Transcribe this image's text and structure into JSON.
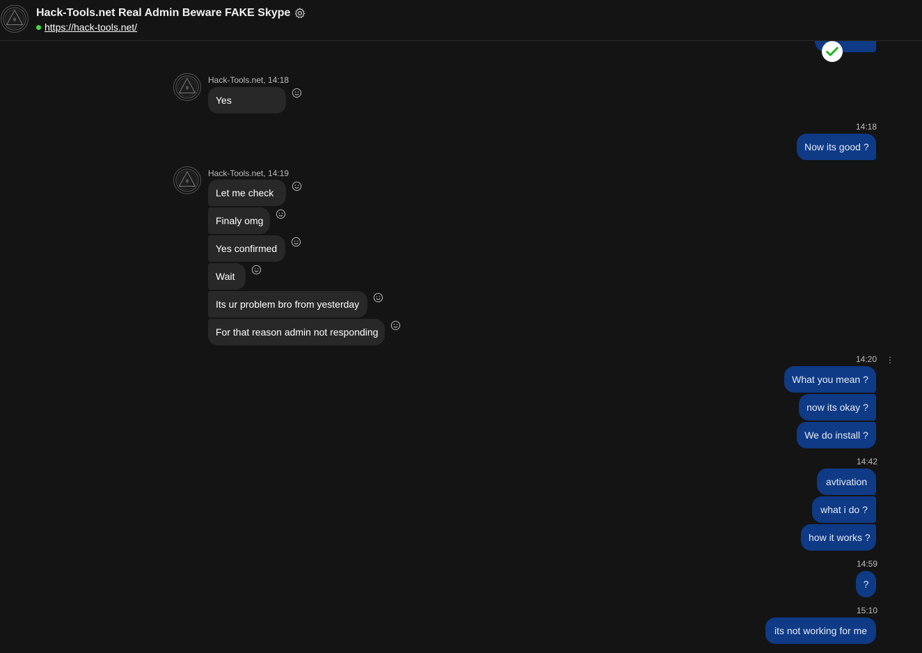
{
  "header": {
    "title": "Hack-Tools.net Real Admin Beware FAKE Skype",
    "url": "https://hack-tools.net/",
    "status": "online",
    "status_color": "#3ddc3d"
  },
  "colors": {
    "incoming_bubble": "#282828",
    "outgoing_bubble": "#0e3a86",
    "background": "#141414"
  },
  "messages": {
    "top_outgoing_read_icon": "check-circle-icon",
    "group1": {
      "sender": "Hack-Tools.net, 14:18",
      "items": [
        "Yes"
      ]
    },
    "group2": {
      "time": "14:18",
      "items": [
        "Now its good ?"
      ]
    },
    "group3": {
      "sender": "Hack-Tools.net, 14:19",
      "items": [
        "Let me check",
        "Finaly omg",
        "Yes confirmed",
        "Wait",
        "Its ur problem bro from yesterday",
        "For that reason admin not responding"
      ]
    },
    "group4": {
      "time": "14:20",
      "items": [
        "What you mean ?",
        "now its okay ?",
        "We do install ?"
      ]
    },
    "group5": {
      "time": "14:42",
      "items": [
        "avtivation",
        "what i do ?",
        "how it works ?"
      ]
    },
    "group6": {
      "time": "14:59",
      "items": [
        "?"
      ]
    },
    "group7": {
      "time": "15:10",
      "items": [
        "its not working for me"
      ]
    }
  }
}
